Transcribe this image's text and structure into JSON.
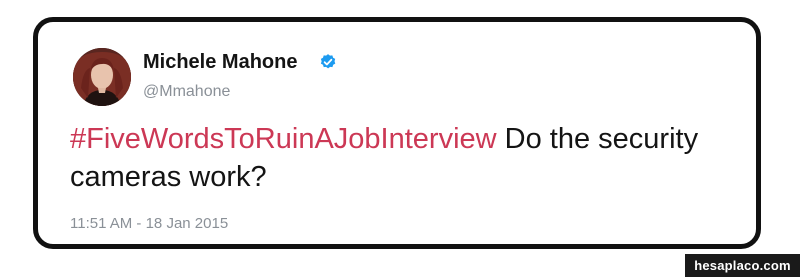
{
  "tweet": {
    "display_name": "Michele Mahone",
    "verified": true,
    "handle": "@Mmahone",
    "hashtag": "#FiveWordsToRuinAJobInterview",
    "body": " Do the security cameras work?",
    "timestamp": "11:51 AM - 18 Jan 2015"
  },
  "avatar": {
    "icon": "profile-photo"
  },
  "watermark": {
    "text": "hesaplaco.com"
  },
  "colors": {
    "hashtag": "#cc3855",
    "verified_badge": "#1d9bf0",
    "secondary_text": "#8a9097",
    "card_border": "#111111"
  }
}
